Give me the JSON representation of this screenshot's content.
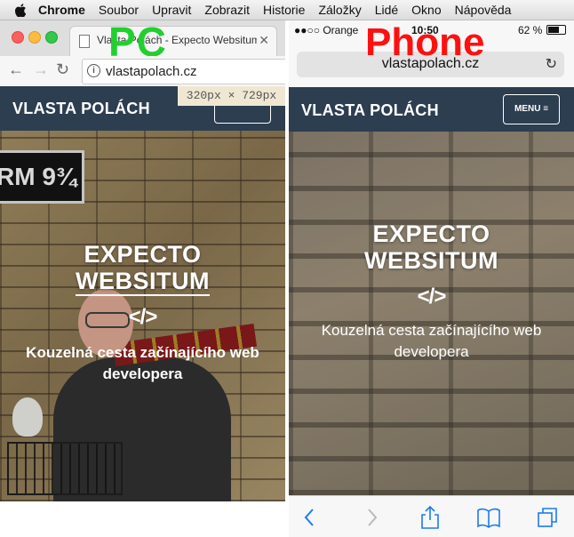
{
  "menubar": {
    "app": "Chrome",
    "items": [
      "Soubor",
      "Upravit",
      "Zobrazit",
      "Historie",
      "Záložky",
      "Lidé",
      "Okno",
      "Nápověda"
    ]
  },
  "pc": {
    "annotation": "PC",
    "tab_title": "Vlasta Polách - Expecto Websitum",
    "url": "vlastapolach.cz",
    "size_tooltip": "320px × 729px"
  },
  "phone": {
    "annotation": "Phone",
    "carrier": "●●○○ Orange",
    "time": "10:50",
    "battery": "62 %",
    "url": "vlastapolach.cz"
  },
  "site": {
    "brand": "VLASTA POLÁCH",
    "menu": "MENU ≡",
    "title_line1": "EXPECTO",
    "title_line2": "WEBSITUM",
    "code_glyph": "</>",
    "subtitle": "Kouzelná cesta začínajícího web developera",
    "platform_sign": "RM 9¾"
  },
  "colors": {
    "header_bg": "#2c3e50",
    "pc_annotation": "#21d02e",
    "phone_annotation": "#ff1010",
    "ios_tint": "#1a7bf2"
  },
  "icons": [
    "apple-icon",
    "back-arrow-icon",
    "forward-arrow-icon",
    "reload-icon",
    "info-icon",
    "close-icon",
    "share-icon",
    "bookmarks-icon",
    "tabs-icon"
  ]
}
